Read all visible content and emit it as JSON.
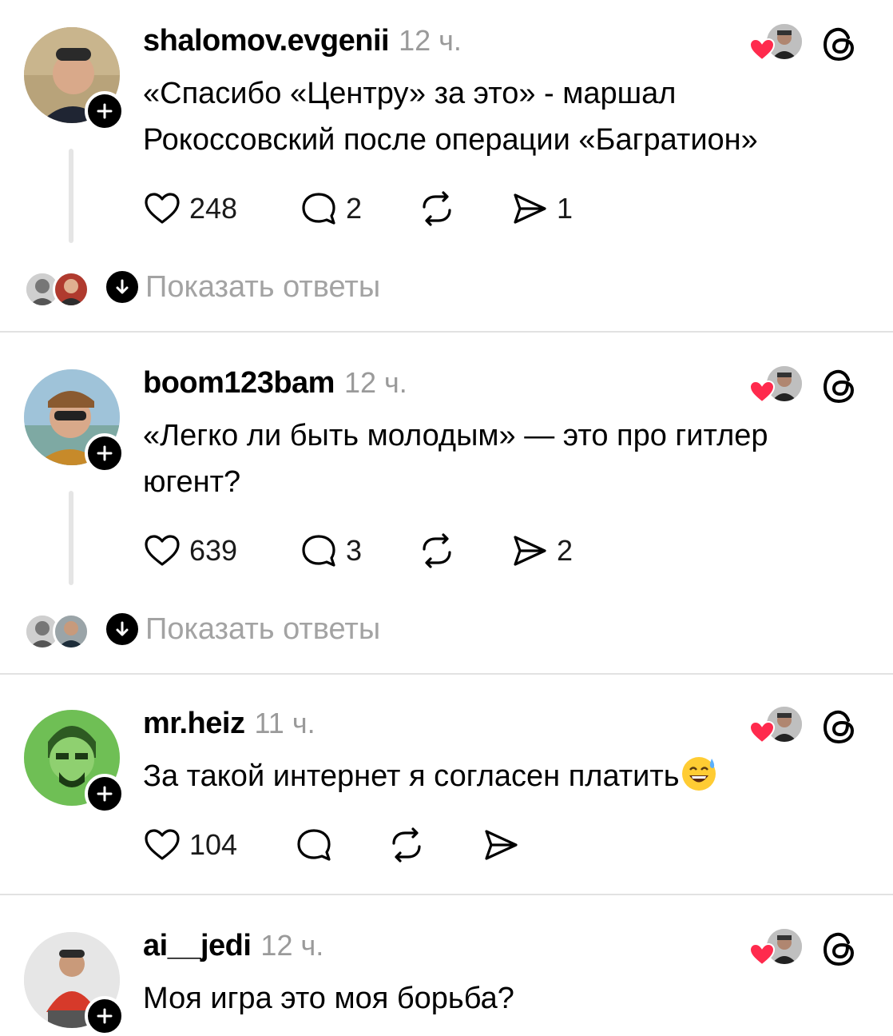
{
  "posts": [
    {
      "username": "shalomov.evgenii",
      "time": "12 ч.",
      "text": "«Спасибо «Центру» за это» - маршал Рокоссовский после операции «Багратион»",
      "likes": "248",
      "comments": "2",
      "reposts": "",
      "shares": "1",
      "show_replies": "Показать ответы",
      "avatar_color": "#7a8a6a"
    },
    {
      "username": "boom123bam",
      "time": "12 ч.",
      "text": "«Легко ли быть молодым» — это про гитлер югент?",
      "likes": "639",
      "comments": "3",
      "reposts": "",
      "shares": "2",
      "show_replies": "Показать ответы",
      "avatar_color": "#9fc3d9"
    },
    {
      "username": "mr.heiz",
      "time": "11 ч.",
      "text": "За такой интернет я согласен платить",
      "emoji": "sweat-smile-emoji",
      "likes": "104",
      "comments": "",
      "reposts": "",
      "shares": "",
      "avatar_color": "#6fbf55"
    },
    {
      "username": "ai__jedi",
      "time": "12 ч.",
      "text": "Моя игра это моя борьба?",
      "avatar_color": "#d8d8d8"
    }
  ],
  "icons": {
    "like": "heart-outline-icon",
    "comment": "speech-bubble-icon",
    "repost": "repost-icon",
    "share": "send-icon",
    "threads": "threads-logo-icon",
    "liked_by_author": "red-heart-icon"
  },
  "colors": {
    "heart_red": "#ff2a4d",
    "muted_text": "#9a9a9a"
  }
}
